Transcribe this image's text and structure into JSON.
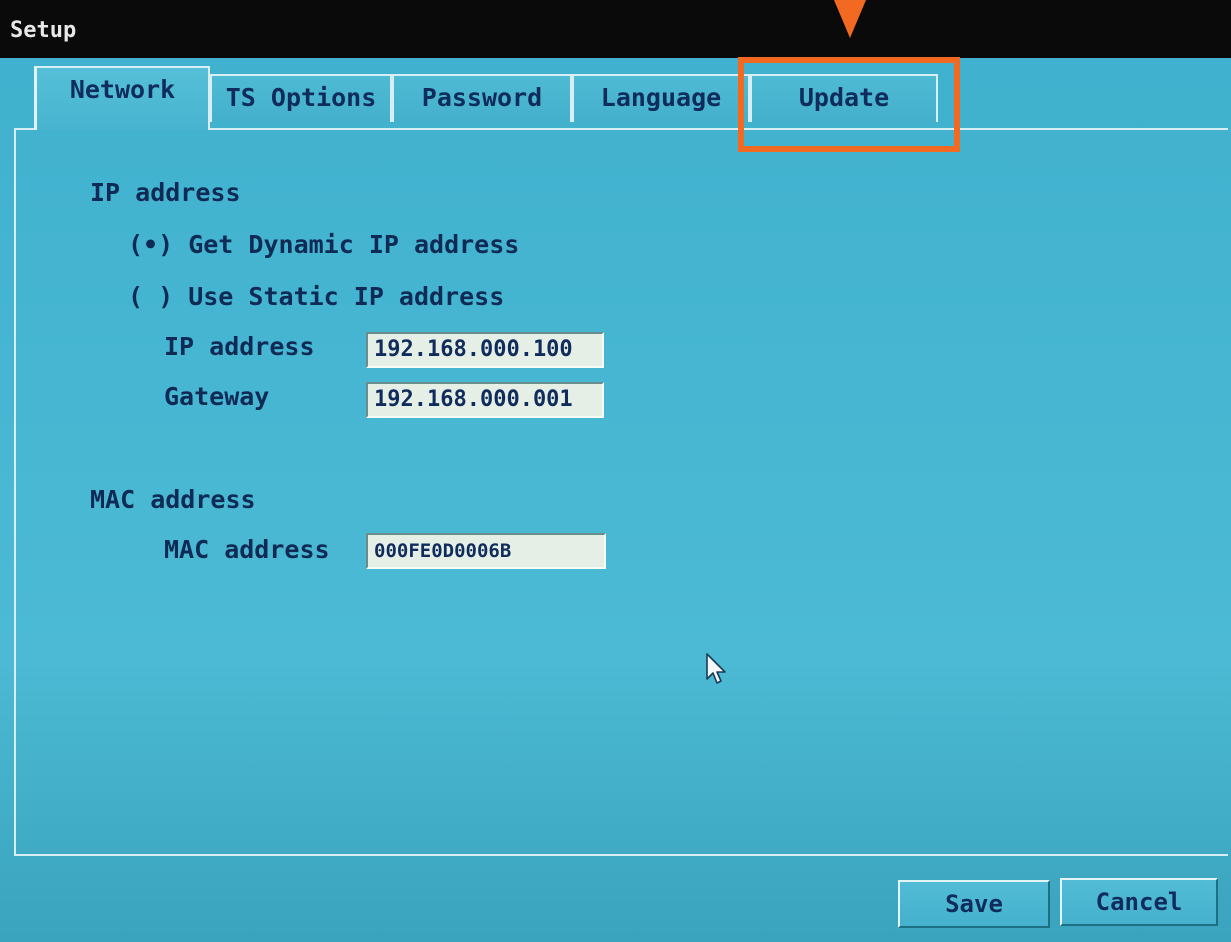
{
  "window": {
    "title": "Setup"
  },
  "tabs": [
    {
      "label": "Network",
      "active": true
    },
    {
      "label": "TS Options",
      "active": false
    },
    {
      "label": "Password",
      "active": false
    },
    {
      "label": "Language",
      "active": false
    },
    {
      "label": "Update",
      "active": false
    }
  ],
  "highlight": {
    "target": "Update",
    "color": "#f26a21"
  },
  "network": {
    "ip_section_label": "IP address",
    "radio_dynamic_label": "(•) Get Dynamic IP address",
    "radio_static_label": "( ) Use Static IP address",
    "dynamic_selected": true,
    "ip_label": "IP address",
    "ip_value": "192.168.000.100",
    "gateway_label": "Gateway",
    "gateway_value": "192.168.000.001",
    "mac_section_label": "MAC address",
    "mac_label": "MAC address",
    "mac_value": "000FE0D0006B"
  },
  "buttons": {
    "save_label": "Save",
    "cancel_label": "Cancel"
  },
  "colors": {
    "titlebar": "#0a0a0a",
    "background": "#46b6d2",
    "text": "#0f2c5c",
    "textbox": "#e6efe6"
  }
}
